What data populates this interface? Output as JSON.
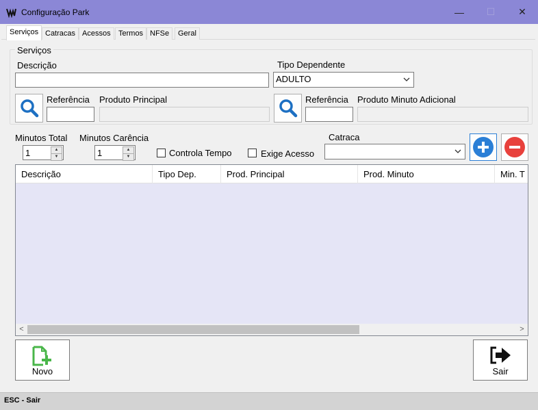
{
  "window": {
    "title": "Configuração Park",
    "controls": {
      "minimize": "—",
      "maximize": "☐",
      "close": "✕"
    }
  },
  "tabs": [
    {
      "label": "Serviços",
      "active": true
    },
    {
      "label": "Catracas"
    },
    {
      "label": "Acessos"
    },
    {
      "label": "Termos"
    },
    {
      "label": "NFSe"
    },
    {
      "label": "Geral"
    }
  ],
  "servicos_group": {
    "title": "Serviços",
    "descricao": {
      "label": "Descrição",
      "value": ""
    },
    "tipo_dependente": {
      "label": "Tipo Dependente",
      "value": "ADULTO"
    },
    "produto_principal": {
      "search_icon": "search-icon",
      "referencia_label": "Referência",
      "referencia_value": "",
      "produto_label": "Produto Principal",
      "produto_value": ""
    },
    "produto_minuto": {
      "search_icon": "search-icon",
      "referencia_label": "Referência",
      "referencia_value": "",
      "produto_label": "Produto Minuto Adicional",
      "produto_value": ""
    }
  },
  "options": {
    "minutos_total": {
      "label": "Minutos Total",
      "value": "1"
    },
    "minutos_carencia": {
      "label": "Minutos Carência",
      "value": "1"
    },
    "controla_tempo": {
      "label": "Controla Tempo",
      "checked": false
    },
    "exige_acesso": {
      "label": "Exige Acesso",
      "checked": false
    },
    "catraca": {
      "label": "Catraca",
      "value": ""
    },
    "add_button_icon": "plus-circle-icon",
    "remove_button_icon": "minus-circle-icon"
  },
  "grid": {
    "columns": [
      "Descrição",
      "Tipo Dep.",
      "Prod. Principal",
      "Prod. Minuto",
      "Min. T"
    ],
    "rows": []
  },
  "buttons": {
    "novo": {
      "label": "Novo",
      "icon": "new-document-icon"
    },
    "sair": {
      "label": "Sair",
      "icon": "exit-arrow-icon"
    }
  },
  "statusbar": {
    "text": "ESC - Sair"
  },
  "colors": {
    "titlebar": "#8b87d6",
    "grid_bg": "#e5e5f6",
    "search_blue": "#1c6fc2",
    "add_blue": "#2b7fd6",
    "remove_red": "#e8413c",
    "novo_green": "#49b649"
  }
}
